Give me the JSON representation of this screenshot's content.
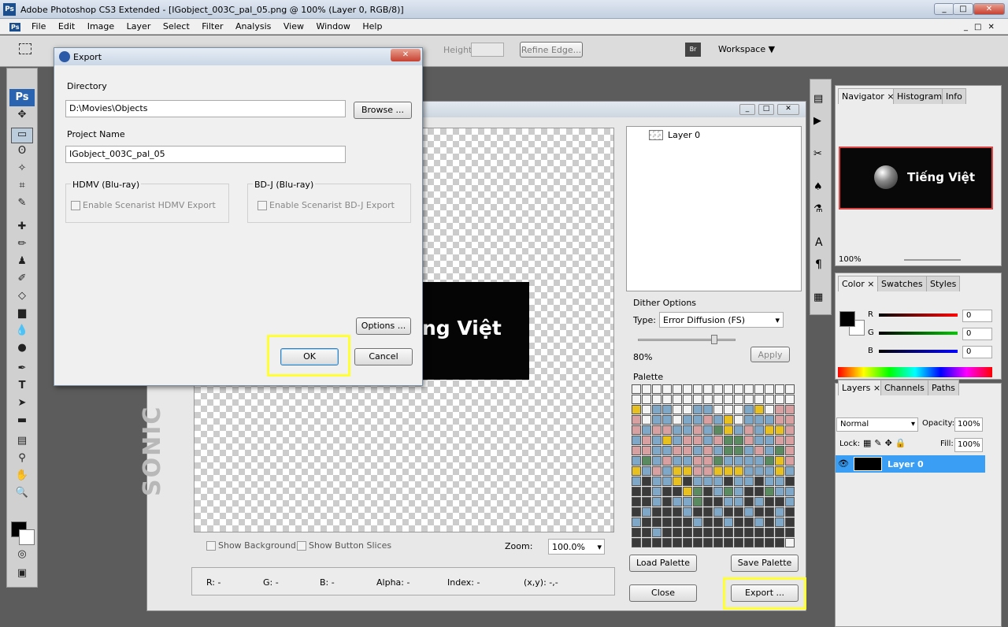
{
  "app": {
    "title": "Adobe Photoshop CS3 Extended - [IGobject_003C_pal_05.png @ 100% (Layer 0, RGB/8)]",
    "logo": "Ps"
  },
  "menu": [
    "File",
    "Edit",
    "Image",
    "Layer",
    "Select",
    "Filter",
    "Analysis",
    "View",
    "Window",
    "Help"
  ],
  "options": {
    "height_label": "Height:",
    "refine_edge": "Refine Edge...",
    "workspace": "Workspace"
  },
  "toolbox": {
    "logo": "Ps"
  },
  "export_dialog": {
    "title": "Export",
    "directory_label": "Directory",
    "directory_value": "D:\\Movies\\Objects",
    "browse": "Browse ...",
    "project_label": "Project Name",
    "project_value": "IGobject_003C_pal_05",
    "hdmv_group": "HDMV (Blu-ray)",
    "hdmv_check": "Enable Scenarist HDMV Export",
    "bdj_group": "BD-J (Blu-ray)",
    "bdj_check": "Enable Scenarist BD-J Export",
    "options": "Options ...",
    "ok": "OK",
    "cancel": "Cancel"
  },
  "sonic": {
    "brand": "SONIC",
    "layer_name": "Layer 0",
    "preview_text": "ng Việt",
    "show_background": "Show Background",
    "show_button_slices": "Show Button Slices",
    "zoom_label": "Zoom:",
    "zoom_value": "100.0%",
    "status": {
      "r": "R: -",
      "g": "G: -",
      "b": "B: -",
      "alpha": "Alpha: -",
      "index": "Index: -",
      "xy": "(x,y): -,-"
    },
    "dither_title": "Dither Options",
    "type_label": "Type:",
    "type_value": "Error Diffusion (FS)",
    "dither_percent": "80%",
    "apply": "Apply",
    "palette_title": "Palette",
    "load_palette": "Load Palette",
    "save_palette": "Save Palette",
    "close": "Close",
    "export": "Export ..."
  },
  "navigator": {
    "tabs": [
      "Navigator",
      "Histogram",
      "Info"
    ],
    "thumb_text": "Tiếng Việt",
    "zoom": "100%"
  },
  "color": {
    "tabs": [
      "Color",
      "Swatches",
      "Styles"
    ],
    "channels": [
      {
        "label": "R",
        "value": "0"
      },
      {
        "label": "G",
        "value": "0"
      },
      {
        "label": "B",
        "value": "0"
      }
    ]
  },
  "layers": {
    "tabs": [
      "Layers",
      "Channels",
      "Paths"
    ],
    "blend": "Normal",
    "opacity_label": "Opacity:",
    "opacity": "100%",
    "lock_label": "Lock:",
    "fill_label": "Fill:",
    "fill": "100%",
    "layer_name": "Layer 0"
  },
  "palette_rows": [
    "wwwwwwwwwwwwwwww",
    "wwwwwwwwwwwwwwww",
    "ywbbwwbbwwwbywpp",
    "pwbbwbbpbywbbbpp",
    "pbppbbpbgybpbyyp",
    "bpbybppbpggpbbpp",
    "ppbbppbpbggbpbgp",
    "bgbpbbppgbbbbgyp",
    "ybpbyyppyyybbbyb",
    "bdbbydbbbdbbdbbd",
    "ddbddygdbgbddgbb",
    "ddbdbbgddbbdbddb",
    "dbdddbddbddbddbd",
    "bdddddbddbddbdbd",
    "ddbddddddddddddd",
    "dddddddddddddddw"
  ]
}
